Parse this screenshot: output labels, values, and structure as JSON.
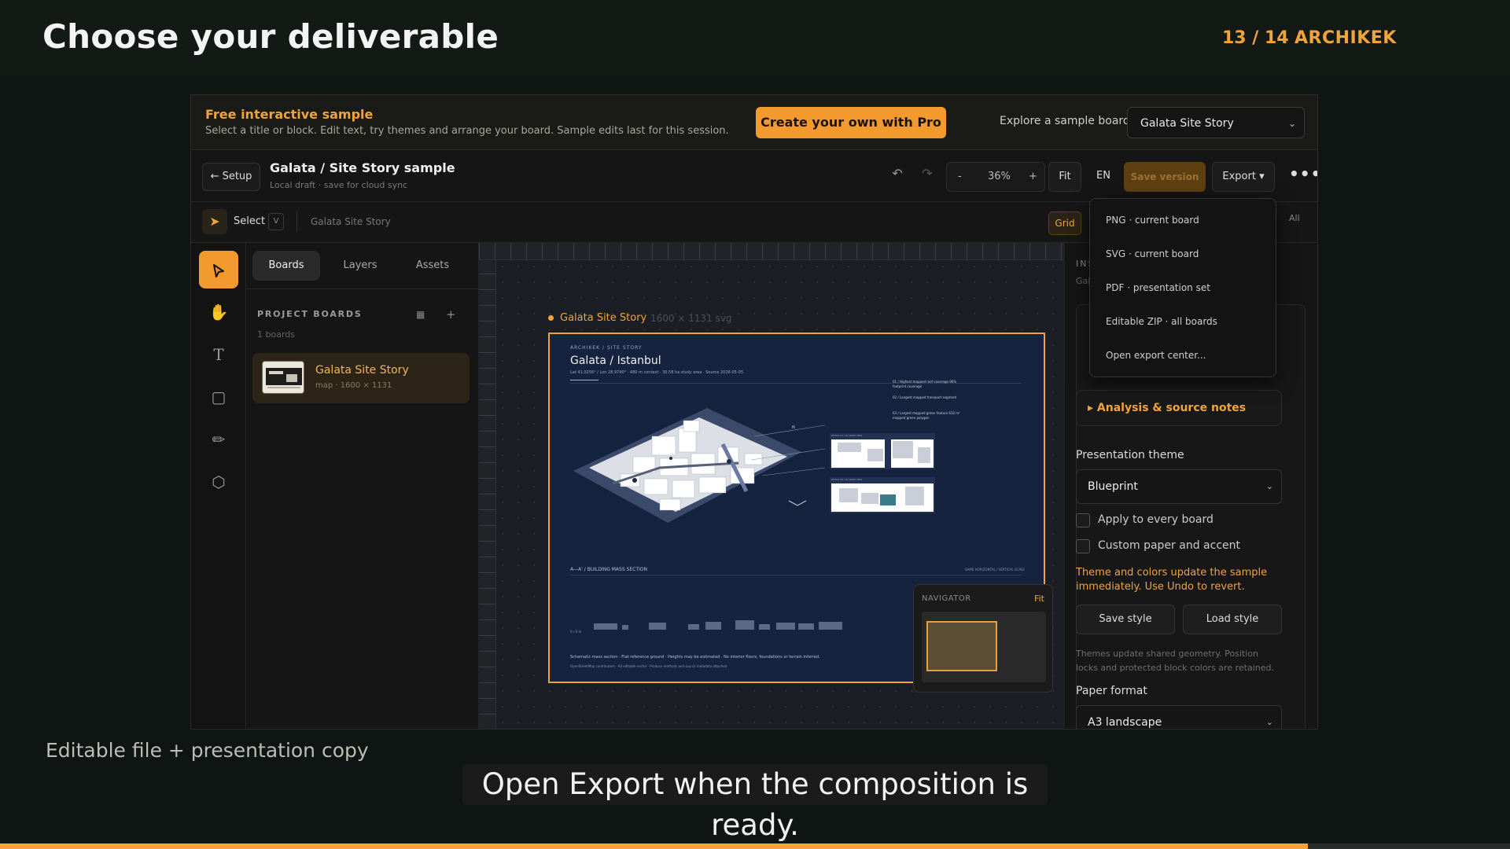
{
  "slide": {
    "title": "Choose your deliverable",
    "counter": "13 / 14",
    "brand": "ARCHIKEK",
    "caption_left": "Editable file + presentation copy",
    "subtitle": "Open Export when the composition is ready.",
    "progress": 0.866,
    "accent_color": "#f0a43a"
  },
  "banner": {
    "title": "Free interactive sample",
    "subtitle": "Select a title or block. Edit text, try themes and arrange your board. Sample edits last for this session.",
    "cta": "Create your own with Pro →",
    "explore_label": "Explore a sample board",
    "sample_select": "Galata Site Story"
  },
  "toolbar": {
    "setup": "← Setup",
    "doc_title": "Galata / Site Story sample",
    "doc_status": "Local draft · save for cloud sync",
    "undo_icon": "undo-icon",
    "redo_icon": "redo-icon",
    "zoom_minus": "-",
    "zoom": "36%",
    "zoom_plus": "+",
    "fit": "Fit",
    "lang": "EN",
    "save_version": "Save version",
    "export": "Export ▾",
    "more": "•••"
  },
  "toolbar2": {
    "select_label": "Select",
    "select_key": "V",
    "crumb": "Galata Site Story",
    "grid": "Grid",
    "all": "All"
  },
  "rail": {
    "tools": [
      "select-tool",
      "hand-tool",
      "text-tool",
      "shape-tool",
      "measure-tool",
      "3d-tool"
    ]
  },
  "boards_panel": {
    "tabs": [
      "Boards",
      "Layers",
      "Assets"
    ],
    "section_title": "PROJECT BOARDS",
    "count": "1 boards",
    "grid_icon": "▦",
    "add_icon": "+",
    "board": {
      "name": "Galata Site Story",
      "meta": "map · 1600 × 1131"
    }
  },
  "canvas": {
    "board_label": "Galata Site Story",
    "board_dims": "1600 × 1131 svg",
    "artboard": {
      "kicker": "ARCHIKEK / SITE STORY",
      "title": "Galata / Istanbul",
      "meta": "Lat 41.0256° / Lon 28.9740° · 480 m context · 30.58 ha study area · Source 2026-05-05",
      "north": "N",
      "legend": [
        "01 / Highest mapped roof coverage 96% footprint coverage",
        "02 / Longest mapped transport segment",
        "03 / Largest mapped green feature 632 m² mapped green polygon"
      ],
      "detail_a": "DETAIL 01 / 01 MAIN VIEW",
      "detail_b": "DETAIL 02 / 01 MAIN VIEW",
      "section_title": "A—A' / BUILDING MASS SECTION",
      "section_scale": "SAME HORIZONTAL / VERTICAL SCALE",
      "note1": "Schematic mass section · Flat reference ground · Heights may be estimated · No interior floors, foundations or terrain inferred.",
      "note2": "OpenStreetMap contributors · A3 editable vector · Produce methods and source metadata attached"
    },
    "navigator": {
      "label": "NAVIGATOR",
      "fit": "Fit"
    }
  },
  "inspector": {
    "head": "INSPECTOR",
    "sub": "Galata Site Story",
    "analysis": "▸ Analysis & source notes",
    "theme_label": "Presentation theme",
    "theme_value": "Blueprint",
    "apply_all": "Apply to every board",
    "custom_paper": "Custom paper and accent",
    "theme_note": "Theme and colors update the sample immediately. Use Undo to revert.",
    "save_style": "Save style",
    "load_style": "Load style",
    "fine_note": "Themes update shared geometry. Position locks and protected block colors are retained.",
    "paper_label": "Paper format",
    "paper_value": "A3 landscape"
  },
  "export_menu": {
    "items": [
      "PNG · current board",
      "SVG · current board",
      "PDF · presentation set",
      "Editable ZIP · all boards",
      "Open export center..."
    ]
  }
}
